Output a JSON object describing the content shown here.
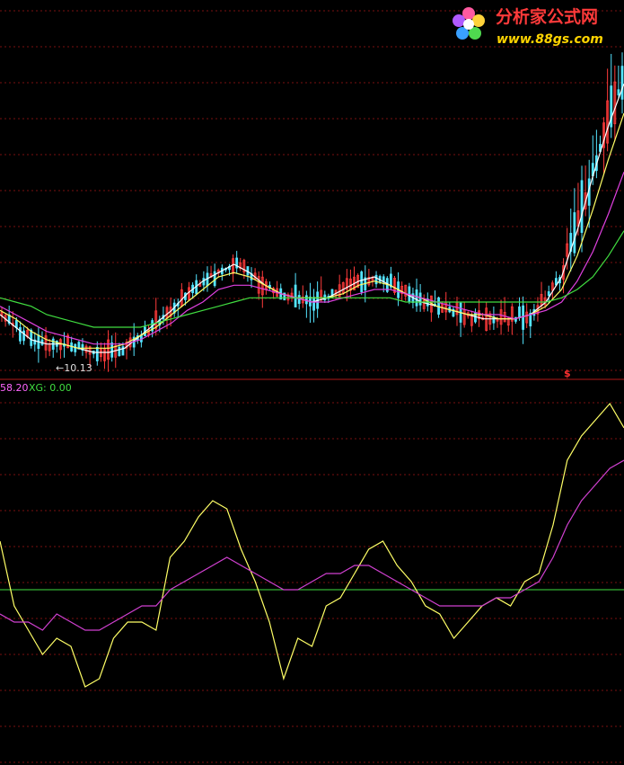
{
  "colors": {
    "background": "#000000",
    "grid": "#7a1010",
    "divider": "#b01818",
    "candle_up": "#ff3b3b",
    "candle_down": "#54e4ff",
    "ma_short": "#ffffff",
    "ma_mid": "#ffff66",
    "ma_long": "#e040e0",
    "ma_longest": "#40dd40",
    "osc_fast": "#ffff66",
    "osc_slow": "#d040d0",
    "zero_line": "#40dd40",
    "low_label": "#dddddd",
    "indicator_text": "#ff66ff",
    "xg_text": "#40dd40",
    "signal_marker": "#ff3030"
  },
  "logo": {
    "text": "分析家公式网",
    "url": "www.88gs.com",
    "icon": "flower-icon"
  },
  "price_panel": {
    "low_marker_label": "←10.13",
    "signal_marker": "$"
  },
  "indicator_panel": {
    "value_text": "58.20",
    "xg_text": "XG: 0.00"
  },
  "chart_data": [
    {
      "type": "line",
      "subtype": "candlestick",
      "ylabel": "",
      "grid": true,
      "low_label_value": 10.13,
      "series": [
        {
          "color_key": "ma_short",
          "values": [
            11.0,
            10.7,
            10.4,
            10.3,
            10.3,
            10.2,
            10.1,
            10.1,
            10.2,
            10.5,
            10.8,
            11.1,
            11.5,
            11.8,
            12.0,
            12.2,
            12.0,
            11.7,
            11.5,
            11.4,
            11.3,
            11.4,
            11.6,
            11.8,
            11.9,
            11.7,
            11.5,
            11.3,
            11.2,
            11.1,
            11.0,
            10.9,
            10.9,
            10.9,
            11.0,
            11.3,
            11.9,
            13.0,
            14.3,
            15.5,
            16.5
          ]
        },
        {
          "color_key": "ma_mid",
          "values": [
            11.1,
            10.9,
            10.6,
            10.4,
            10.3,
            10.2,
            10.2,
            10.2,
            10.3,
            10.5,
            10.7,
            11.0,
            11.3,
            11.6,
            11.9,
            12.0,
            11.9,
            11.7,
            11.5,
            11.4,
            11.4,
            11.4,
            11.5,
            11.7,
            11.8,
            11.7,
            11.5,
            11.4,
            11.2,
            11.1,
            11.0,
            11.0,
            10.9,
            10.9,
            11.0,
            11.2,
            11.6,
            12.4,
            13.5,
            14.7,
            15.8
          ]
        },
        {
          "color_key": "ma_long",
          "values": [
            11.2,
            11.0,
            10.8,
            10.6,
            10.5,
            10.4,
            10.3,
            10.3,
            10.3,
            10.4,
            10.6,
            10.8,
            11.1,
            11.3,
            11.6,
            11.7,
            11.7,
            11.6,
            11.5,
            11.4,
            11.3,
            11.3,
            11.4,
            11.5,
            11.6,
            11.6,
            11.5,
            11.4,
            11.3,
            11.2,
            11.1,
            11.0,
            11.0,
            10.9,
            11.0,
            11.1,
            11.3,
            11.8,
            12.5,
            13.4,
            14.4
          ]
        },
        {
          "color_key": "ma_longest",
          "values": [
            11.4,
            11.3,
            11.2,
            11.0,
            10.9,
            10.8,
            10.7,
            10.7,
            10.7,
            10.7,
            10.8,
            10.9,
            11.0,
            11.1,
            11.2,
            11.3,
            11.4,
            11.4,
            11.4,
            11.4,
            11.4,
            11.4,
            11.4,
            11.4,
            11.4,
            11.4,
            11.3,
            11.3,
            11.3,
            11.3,
            11.3,
            11.3,
            11.3,
            11.3,
            11.3,
            11.3,
            11.4,
            11.6,
            11.9,
            12.4,
            13.0
          ]
        }
      ]
    },
    {
      "type": "line",
      "grid": true,
      "reference_line": 0,
      "series": [
        {
          "name": "58.20",
          "color_key": "osc_fast",
          "values": [
            30,
            -10,
            -25,
            -40,
            -30,
            -35,
            -60,
            -55,
            -30,
            -20,
            -20,
            -25,
            20,
            30,
            45,
            55,
            50,
            25,
            5,
            -20,
            -55,
            -30,
            -35,
            -10,
            -5,
            10,
            25,
            30,
            15,
            5,
            -10,
            -15,
            -30,
            -20,
            -10,
            -5,
            -10,
            5,
            10,
            40,
            80,
            95,
            105,
            115,
            100
          ]
        },
        {
          "name": "XG",
          "color_key": "osc_slow",
          "values": [
            -15,
            -20,
            -20,
            -25,
            -15,
            -20,
            -25,
            -25,
            -20,
            -15,
            -10,
            -10,
            0,
            5,
            10,
            15,
            20,
            15,
            10,
            5,
            0,
            0,
            5,
            10,
            10,
            15,
            15,
            10,
            5,
            0,
            -5,
            -10,
            -10,
            -10,
            -10,
            -5,
            -5,
            0,
            5,
            20,
            40,
            55,
            65,
            75,
            80
          ]
        }
      ]
    }
  ]
}
